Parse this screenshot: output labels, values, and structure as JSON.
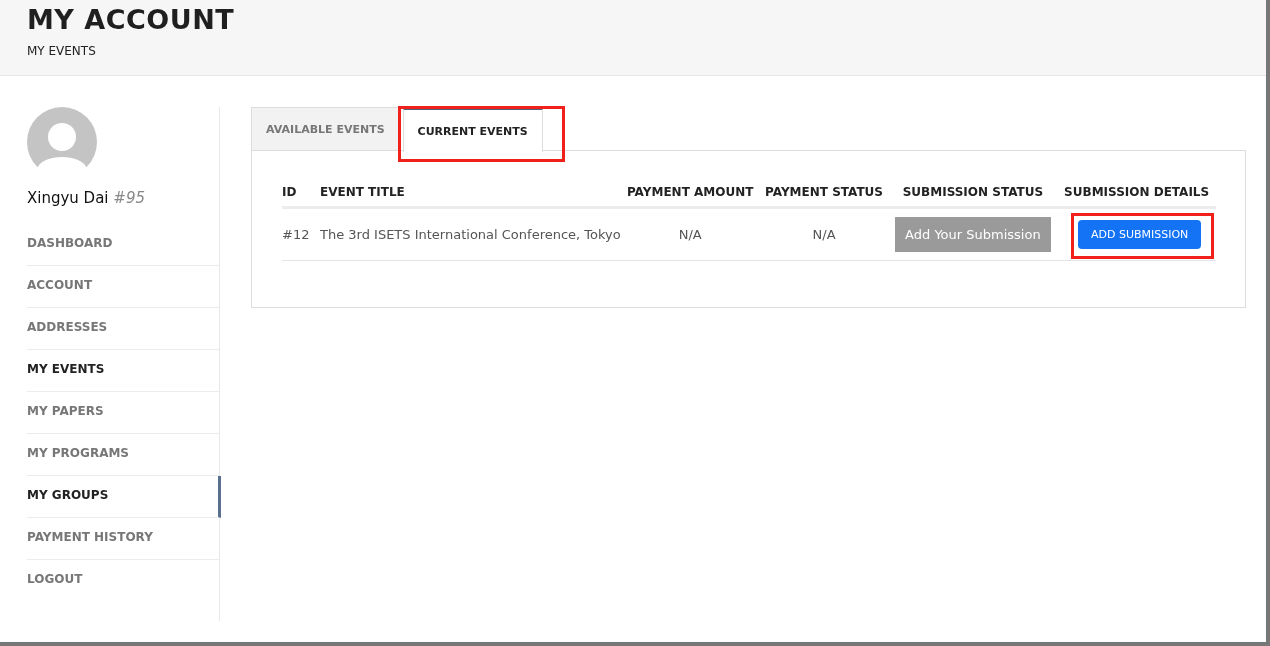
{
  "header": {
    "title": "MY ACCOUNT",
    "breadcrumb": "MY EVENTS"
  },
  "profile": {
    "name": "Xingyu Dai",
    "number": "#95"
  },
  "sidebar": {
    "items": [
      {
        "label": "DASHBOARD",
        "current": false,
        "selected": false
      },
      {
        "label": "ACCOUNT",
        "current": false,
        "selected": false
      },
      {
        "label": "ADDRESSES",
        "current": false,
        "selected": false
      },
      {
        "label": "MY EVENTS",
        "current": true,
        "selected": false
      },
      {
        "label": "MY PAPERS",
        "current": false,
        "selected": false
      },
      {
        "label": "MY PROGRAMS",
        "current": false,
        "selected": false
      },
      {
        "label": "MY GROUPS",
        "current": false,
        "selected": true
      },
      {
        "label": "PAYMENT HISTORY",
        "current": false,
        "selected": false
      },
      {
        "label": "LOGOUT",
        "current": false,
        "selected": false
      }
    ]
  },
  "tabs": [
    {
      "label": "AVAILABLE EVENTS",
      "selected": false,
      "highlighted": false
    },
    {
      "label": "CURRENT EVENTS",
      "selected": true,
      "highlighted": true
    }
  ],
  "table": {
    "columns": [
      "ID",
      "EVENT TITLE",
      "PAYMENT AMOUNT",
      "PAYMENT STATUS",
      "SUBMISSION STATUS",
      "SUBMISSION DETAILS"
    ],
    "rows": [
      {
        "id": "#12",
        "title": "The 3rd ISETS International Conference, Tokyo",
        "payment_amount": "N/A",
        "payment_status": "N/A",
        "submission_status": "Add Your Submission",
        "details_button": "ADD SUBMISSION",
        "details_highlighted": true
      }
    ]
  }
}
